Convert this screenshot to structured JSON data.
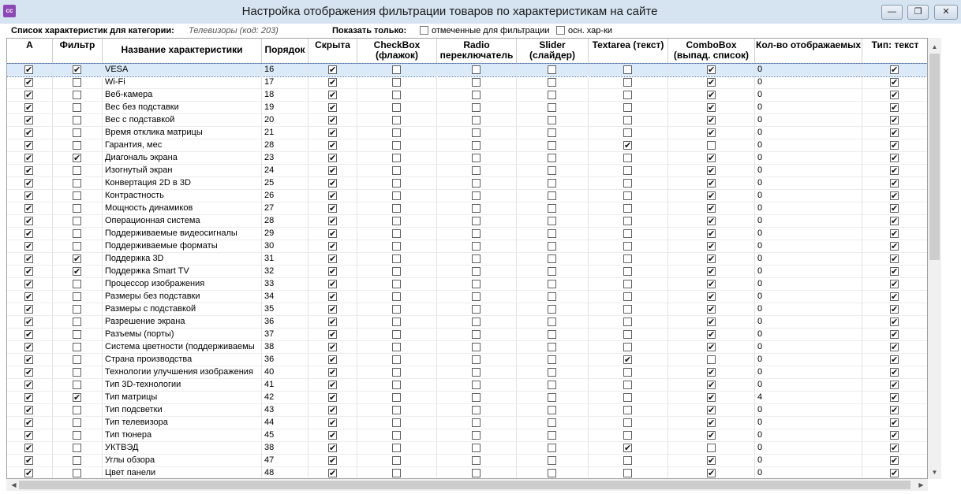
{
  "window": {
    "icon": "app-logo-icon",
    "title": "Настройка отображения  фильтрации товаров по характеристикам на сайте",
    "min_icon": "minimize-icon",
    "max_icon": "restore-icon",
    "close_icon": "close-icon"
  },
  "toolbar": {
    "category_label": "Список характеристик для категории:",
    "category_value": "Телевизоры (код: 203)",
    "show_only_label": "Показать только:",
    "option_filtered_label": "отмеченные для фильтрации",
    "option_main_label": "осн. хар-ки",
    "option_filtered_checked": false,
    "option_main_checked": false
  },
  "columns": {
    "a": "А",
    "filter": "Фильтр",
    "name": "Название характеристики",
    "order": "Порядок",
    "hidden": "Скрыта",
    "checkbox": "CheckBox (флажок)",
    "radio": "Radio переключатель",
    "slider": "Slider (слайдер)",
    "textarea": "Textarea (текст)",
    "combobox": "ComboBox (выпад. список)",
    "count": "Кол-во отображаемых",
    "type_text": "Тип: текст"
  },
  "rows": [
    {
      "a": true,
      "filter": true,
      "name": "VESA",
      "order": "16",
      "hidden": true,
      "checkbox": false,
      "radio": false,
      "slider": false,
      "textarea": false,
      "combobox": true,
      "count": "0",
      "type_text": true
    },
    {
      "a": true,
      "filter": false,
      "name": "Wi-Fi",
      "order": "17",
      "hidden": true,
      "checkbox": false,
      "radio": false,
      "slider": false,
      "textarea": false,
      "combobox": true,
      "count": "0",
      "type_text": true
    },
    {
      "a": true,
      "filter": false,
      "name": "Веб-камера",
      "order": "18",
      "hidden": true,
      "checkbox": false,
      "radio": false,
      "slider": false,
      "textarea": false,
      "combobox": true,
      "count": "0",
      "type_text": true
    },
    {
      "a": true,
      "filter": false,
      "name": "Вес без подставки",
      "order": "19",
      "hidden": true,
      "checkbox": false,
      "radio": false,
      "slider": false,
      "textarea": false,
      "combobox": true,
      "count": "0",
      "type_text": true
    },
    {
      "a": true,
      "filter": false,
      "name": "Вес с подставкой",
      "order": "20",
      "hidden": true,
      "checkbox": false,
      "radio": false,
      "slider": false,
      "textarea": false,
      "combobox": true,
      "count": "0",
      "type_text": true
    },
    {
      "a": true,
      "filter": false,
      "name": "Время отклика матрицы",
      "order": "21",
      "hidden": true,
      "checkbox": false,
      "radio": false,
      "slider": false,
      "textarea": false,
      "combobox": true,
      "count": "0",
      "type_text": true
    },
    {
      "a": true,
      "filter": false,
      "name": "Гарантия, мес",
      "order": "28",
      "hidden": true,
      "checkbox": false,
      "radio": false,
      "slider": false,
      "textarea": true,
      "combobox": false,
      "count": "0",
      "type_text": true
    },
    {
      "a": true,
      "filter": true,
      "name": "Диагональ экрана",
      "order": "23",
      "hidden": true,
      "checkbox": false,
      "radio": false,
      "slider": false,
      "textarea": false,
      "combobox": true,
      "count": "0",
      "type_text": true
    },
    {
      "a": true,
      "filter": false,
      "name": "Изогнутый экран",
      "order": "24",
      "hidden": true,
      "checkbox": false,
      "radio": false,
      "slider": false,
      "textarea": false,
      "combobox": true,
      "count": "0",
      "type_text": true
    },
    {
      "a": true,
      "filter": false,
      "name": "Конвертация 2D в 3D",
      "order": "25",
      "hidden": true,
      "checkbox": false,
      "radio": false,
      "slider": false,
      "textarea": false,
      "combobox": true,
      "count": "0",
      "type_text": true
    },
    {
      "a": true,
      "filter": false,
      "name": "Контрастность",
      "order": "26",
      "hidden": true,
      "checkbox": false,
      "radio": false,
      "slider": false,
      "textarea": false,
      "combobox": true,
      "count": "0",
      "type_text": true
    },
    {
      "a": true,
      "filter": false,
      "name": "Мощность динамиков",
      "order": "27",
      "hidden": true,
      "checkbox": false,
      "radio": false,
      "slider": false,
      "textarea": false,
      "combobox": true,
      "count": "0",
      "type_text": true
    },
    {
      "a": true,
      "filter": false,
      "name": "Операционная система",
      "order": "28",
      "hidden": true,
      "checkbox": false,
      "radio": false,
      "slider": false,
      "textarea": false,
      "combobox": true,
      "count": "0",
      "type_text": true
    },
    {
      "a": true,
      "filter": false,
      "name": "Поддерживаемые видеосигналы",
      "order": "29",
      "hidden": true,
      "checkbox": false,
      "radio": false,
      "slider": false,
      "textarea": false,
      "combobox": true,
      "count": "0",
      "type_text": true
    },
    {
      "a": true,
      "filter": false,
      "name": "Поддерживаемые форматы",
      "order": "30",
      "hidden": true,
      "checkbox": false,
      "radio": false,
      "slider": false,
      "textarea": false,
      "combobox": true,
      "count": "0",
      "type_text": true
    },
    {
      "a": true,
      "filter": true,
      "name": "Поддержка 3D",
      "order": "31",
      "hidden": true,
      "checkbox": false,
      "radio": false,
      "slider": false,
      "textarea": false,
      "combobox": true,
      "count": "0",
      "type_text": true
    },
    {
      "a": true,
      "filter": true,
      "name": "Поддержка Smart TV",
      "order": "32",
      "hidden": true,
      "checkbox": false,
      "radio": false,
      "slider": false,
      "textarea": false,
      "combobox": true,
      "count": "0",
      "type_text": true
    },
    {
      "a": true,
      "filter": false,
      "name": "Процессор изображения",
      "order": "33",
      "hidden": true,
      "checkbox": false,
      "radio": false,
      "slider": false,
      "textarea": false,
      "combobox": true,
      "count": "0",
      "type_text": true
    },
    {
      "a": true,
      "filter": false,
      "name": "Размеры без подставки",
      "order": "34",
      "hidden": true,
      "checkbox": false,
      "radio": false,
      "slider": false,
      "textarea": false,
      "combobox": true,
      "count": "0",
      "type_text": true
    },
    {
      "a": true,
      "filter": false,
      "name": "Размеры с подставкой",
      "order": "35",
      "hidden": true,
      "checkbox": false,
      "radio": false,
      "slider": false,
      "textarea": false,
      "combobox": true,
      "count": "0",
      "type_text": true
    },
    {
      "a": true,
      "filter": false,
      "name": "Разрешение экрана",
      "order": "36",
      "hidden": true,
      "checkbox": false,
      "radio": false,
      "slider": false,
      "textarea": false,
      "combobox": true,
      "count": "0",
      "type_text": true
    },
    {
      "a": true,
      "filter": false,
      "name": "Разъемы (порты)",
      "order": "37",
      "hidden": true,
      "checkbox": false,
      "radio": false,
      "slider": false,
      "textarea": false,
      "combobox": true,
      "count": "0",
      "type_text": true
    },
    {
      "a": true,
      "filter": false,
      "name": "Система цветности (поддерживаемы",
      "order": "38",
      "hidden": true,
      "checkbox": false,
      "radio": false,
      "slider": false,
      "textarea": false,
      "combobox": true,
      "count": "0",
      "type_text": true
    },
    {
      "a": true,
      "filter": false,
      "name": "Страна производства",
      "order": "36",
      "hidden": true,
      "checkbox": false,
      "radio": false,
      "slider": false,
      "textarea": true,
      "combobox": false,
      "count": "0",
      "type_text": true
    },
    {
      "a": true,
      "filter": false,
      "name": "Технологии улучшения изображения",
      "order": "40",
      "hidden": true,
      "checkbox": false,
      "radio": false,
      "slider": false,
      "textarea": false,
      "combobox": true,
      "count": "0",
      "type_text": true
    },
    {
      "a": true,
      "filter": false,
      "name": "Тип 3D-технологии",
      "order": "41",
      "hidden": true,
      "checkbox": false,
      "radio": false,
      "slider": false,
      "textarea": false,
      "combobox": true,
      "count": "0",
      "type_text": true
    },
    {
      "a": true,
      "filter": true,
      "name": "Тип матрицы",
      "order": "42",
      "hidden": true,
      "checkbox": false,
      "radio": false,
      "slider": false,
      "textarea": false,
      "combobox": true,
      "count": "4",
      "type_text": true
    },
    {
      "a": true,
      "filter": false,
      "name": "Тип подсветки",
      "order": "43",
      "hidden": true,
      "checkbox": false,
      "radio": false,
      "slider": false,
      "textarea": false,
      "combobox": true,
      "count": "0",
      "type_text": true
    },
    {
      "a": true,
      "filter": false,
      "name": "Тип телевизора",
      "order": "44",
      "hidden": true,
      "checkbox": false,
      "radio": false,
      "slider": false,
      "textarea": false,
      "combobox": true,
      "count": "0",
      "type_text": true
    },
    {
      "a": true,
      "filter": false,
      "name": "Тип тюнера",
      "order": "45",
      "hidden": true,
      "checkbox": false,
      "radio": false,
      "slider": false,
      "textarea": false,
      "combobox": true,
      "count": "0",
      "type_text": true
    },
    {
      "a": true,
      "filter": false,
      "name": "УКТВЭД",
      "order": "38",
      "hidden": true,
      "checkbox": false,
      "radio": false,
      "slider": false,
      "textarea": true,
      "combobox": false,
      "count": "0",
      "type_text": true
    },
    {
      "a": true,
      "filter": false,
      "name": "Углы обзора",
      "order": "47",
      "hidden": true,
      "checkbox": false,
      "radio": false,
      "slider": false,
      "textarea": false,
      "combobox": true,
      "count": "0",
      "type_text": true
    },
    {
      "a": true,
      "filter": false,
      "name": "Цвет панели",
      "order": "48",
      "hidden": true,
      "checkbox": false,
      "radio": false,
      "slider": false,
      "textarea": false,
      "combobox": true,
      "count": "0",
      "type_text": true
    }
  ],
  "selected_row": 0,
  "icons": {
    "scroll_up": "arrow-up-icon",
    "scroll_down": "arrow-down-icon",
    "scroll_left": "arrow-left-icon",
    "scroll_right": "arrow-right-icon"
  }
}
